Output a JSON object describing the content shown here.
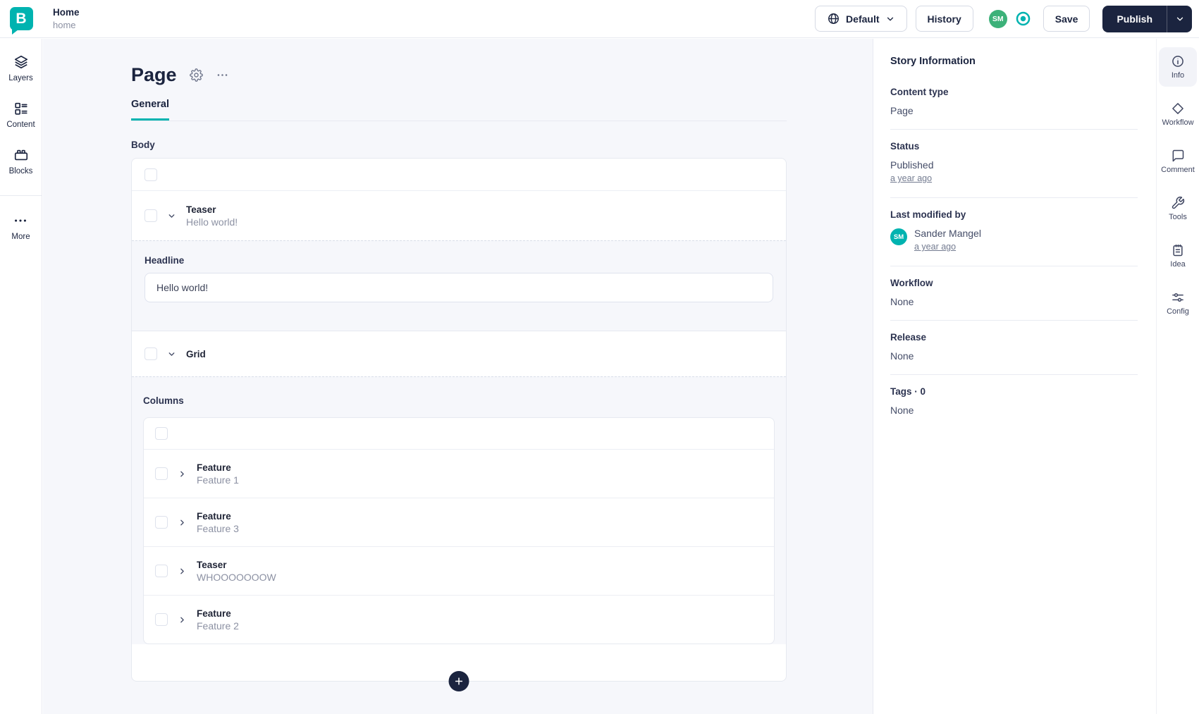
{
  "colors": {
    "teal": "#00b3b0",
    "navy": "#1b243f",
    "green": "#3cb179"
  },
  "header": {
    "breadcrumb": {
      "title": "Home",
      "slug": "home"
    },
    "language_button": "Default",
    "history_button": "History",
    "avatar_initials": "SM",
    "save_button": "Save",
    "publish_button": "Publish"
  },
  "left_nav": {
    "items": [
      {
        "label": "Layers"
      },
      {
        "label": "Content"
      },
      {
        "label": "Blocks"
      },
      {
        "label": "More"
      }
    ]
  },
  "editor": {
    "title": "Page",
    "tab_general": "General",
    "body_label": "Body",
    "teaser_block": {
      "type": "Teaser",
      "preview": "Hello world!"
    },
    "headline_field": {
      "label": "Headline",
      "value": "Hello world!"
    },
    "grid_block": {
      "type": "Grid"
    },
    "columns_label": "Columns",
    "grid_items": [
      {
        "type": "Feature",
        "preview": "Feature 1"
      },
      {
        "type": "Feature",
        "preview": "Feature 3"
      },
      {
        "type": "Teaser",
        "preview": "WHOOOOOOOW"
      },
      {
        "type": "Feature",
        "preview": "Feature 2"
      }
    ]
  },
  "story_info": {
    "title": "Story Information",
    "content_type": {
      "label": "Content type",
      "value": "Page"
    },
    "status": {
      "label": "Status",
      "value": "Published",
      "time_link": "a year ago"
    },
    "last_modified": {
      "label": "Last modified by",
      "user": "Sander Mangel",
      "initials": "SM",
      "time_link": "a year ago"
    },
    "workflow": {
      "label": "Workflow",
      "value": "None"
    },
    "release": {
      "label": "Release",
      "value": "None"
    },
    "tags": {
      "label": "Tags · 0",
      "value": "None"
    }
  },
  "right_rail": {
    "items": [
      {
        "label": "Info"
      },
      {
        "label": "Workflow"
      },
      {
        "label": "Comment"
      },
      {
        "label": "Tools"
      },
      {
        "label": "Idea"
      },
      {
        "label": "Config"
      }
    ]
  }
}
